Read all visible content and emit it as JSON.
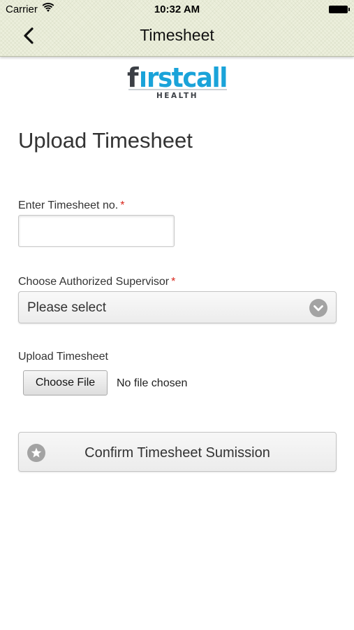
{
  "status_bar": {
    "carrier": "Carrier",
    "time": "10:32 AM"
  },
  "nav": {
    "title": "Timesheet",
    "back_icon": "chevron-left-icon"
  },
  "logo": {
    "brand_part1": "f",
    "brand_part2": "rstcall",
    "sub": "HEALTH",
    "brand_color": "#1aa3d9"
  },
  "page": {
    "title": "Upload Timesheet"
  },
  "form": {
    "timesheet_no": {
      "label": "Enter Timesheet no.",
      "required_mark": "*",
      "value": "",
      "placeholder": ""
    },
    "supervisor": {
      "label": "Choose Authorized Supervisor",
      "required_mark": "*",
      "selected": "Please select",
      "icon": "chevron-down-circle-icon"
    },
    "upload": {
      "label": "Upload Timesheet",
      "button_label": "Choose File",
      "file_status": "No file chosen"
    },
    "confirm": {
      "label": "Confirm Timesheet Sumission",
      "icon": "star-circle-icon"
    }
  },
  "colors": {
    "required": "#d9261c",
    "header_bg": "#ecefdc",
    "icon_gray": "#a3a3a3"
  }
}
